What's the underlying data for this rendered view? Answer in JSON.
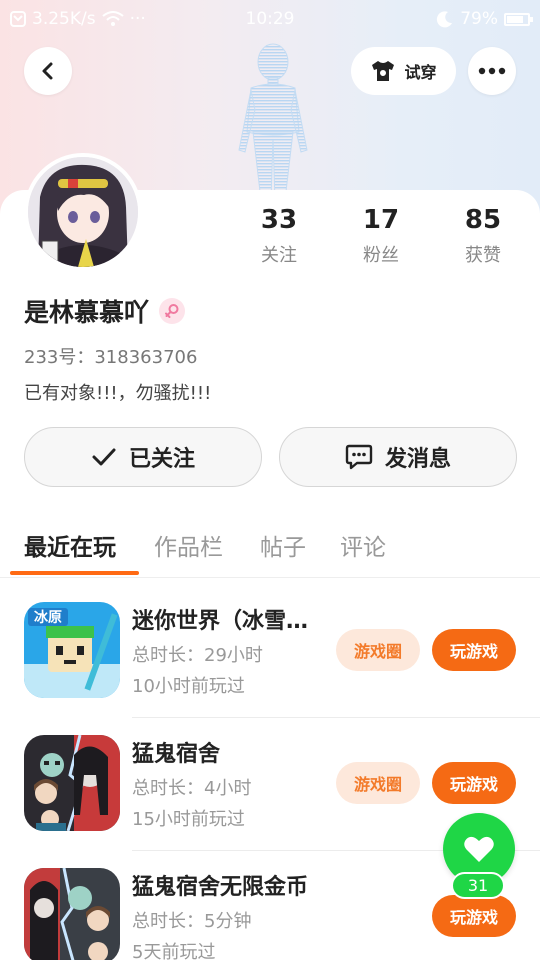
{
  "status_bar": {
    "network_speed": "3.25K/s",
    "dots": "···",
    "time": "10:29",
    "battery": "79%"
  },
  "header": {
    "try_on_label": "试穿",
    "icons": [
      "back-icon",
      "shirt-icon",
      "more-icon"
    ]
  },
  "profile": {
    "stats": [
      {
        "count": "33",
        "label": "关注"
      },
      {
        "count": "17",
        "label": "粉丝"
      },
      {
        "count": "85",
        "label": "获赞"
      }
    ],
    "username": "是林慕慕吖",
    "gender": "female",
    "uid_text": "233号：318363706",
    "bio": "已有对象!!!，勿骚扰!!!"
  },
  "actions": {
    "follow_label": "已关注",
    "message_label": "发消息"
  },
  "tabs": [
    {
      "label": "最近在玩",
      "active": true
    },
    {
      "label": "作品栏",
      "active": false
    },
    {
      "label": "帖子",
      "active": false
    },
    {
      "label": "评论",
      "active": false
    }
  ],
  "games": [
    {
      "title": "迷你世界（冰雪…",
      "duration": "总时长：29小时",
      "last_played": "10小时前玩过",
      "circle_label": "游戏圈",
      "play_label": "玩游戏",
      "icon_text": "冰原"
    },
    {
      "title": "猛鬼宿舍",
      "duration": "总时长：4小时",
      "last_played": "15小时前玩过",
      "circle_label": "游戏圈",
      "play_label": "玩游戏"
    },
    {
      "title": "猛鬼宿舍无限金币",
      "duration": "总时长：5分钟",
      "last_played": "5天前玩过",
      "play_label": "玩游戏"
    }
  ],
  "like": {
    "count": "31"
  },
  "colors": {
    "accent": "#f56a14",
    "accent_light": "#fde8db",
    "like_green": "#1fd646",
    "header_gradient": [
      "#fbe3e4",
      "#e2ecf8"
    ]
  }
}
